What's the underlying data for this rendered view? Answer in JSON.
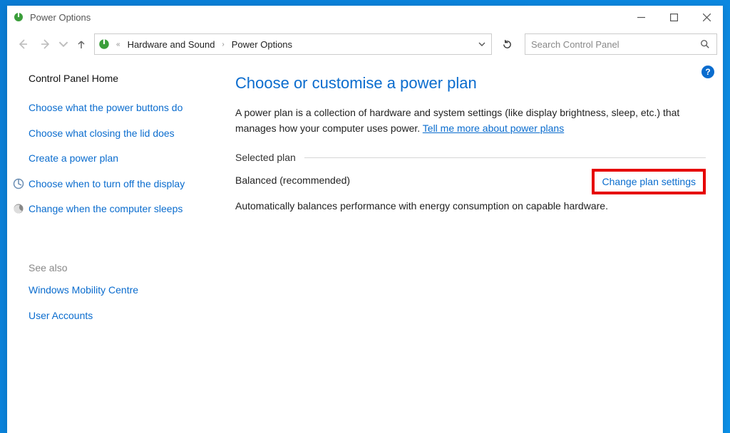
{
  "window": {
    "title": "Power Options"
  },
  "breadcrumb": {
    "prefix": "«",
    "items": [
      "Hardware and Sound",
      "Power Options"
    ]
  },
  "search": {
    "placeholder": "Search Control Panel"
  },
  "sidebar": {
    "home": "Control Panel Home",
    "links": [
      "Choose what the power buttons do",
      "Choose what closing the lid does",
      "Create a power plan",
      "Choose when to turn off the display",
      "Change when the computer sleeps"
    ],
    "seealso_header": "See also",
    "seealso": [
      "Windows Mobility Centre",
      "User Accounts"
    ]
  },
  "main": {
    "heading": "Choose or customise a power plan",
    "description_pre": "A power plan is a collection of hardware and system settings (like display brightness, sleep, etc.) that manages how your computer uses power. ",
    "description_link": "Tell me more about power plans",
    "section_label": "Selected plan",
    "plan_name": "Balanced (recommended)",
    "change_link": "Change plan settings",
    "plan_description": "Automatically balances performance with energy consumption on capable hardware."
  },
  "help_glyph": "?"
}
